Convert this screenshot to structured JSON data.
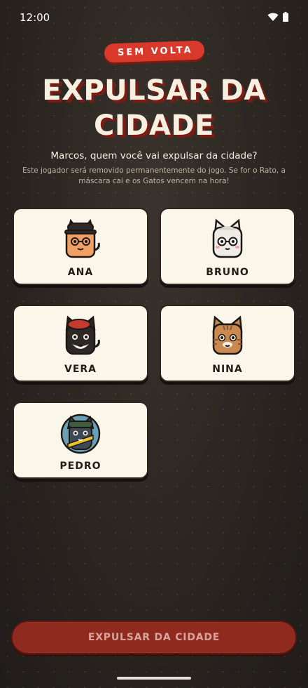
{
  "status": {
    "time": "12:00"
  },
  "badge": "SEM VOLTA",
  "title_line1": "EXPULSAR DA",
  "title_line2": "CIDADE",
  "subtitle": "Marcos, quem você vai expulsar da cidade?",
  "description": "Este jogador será removido permanentemente do jogo. Se for o Rato, a máscara cai e os Gatos vencem na hora!",
  "players": [
    {
      "name": "ANA",
      "avatar": "cat-with-dark-hat"
    },
    {
      "name": "BRUNO",
      "avatar": "white-cat-with-glasses"
    },
    {
      "name": "VERA",
      "avatar": "black-cat-with-red-beret"
    },
    {
      "name": "NINA",
      "avatar": "tabby-cat"
    },
    {
      "name": "PEDRO",
      "avatar": "cat-in-round-badge"
    }
  ],
  "cta_label": "EXPULSAR DA CIDADE",
  "colors": {
    "accent": "#d8392b",
    "card": "#fbf6ea",
    "background": "#2b2622"
  }
}
